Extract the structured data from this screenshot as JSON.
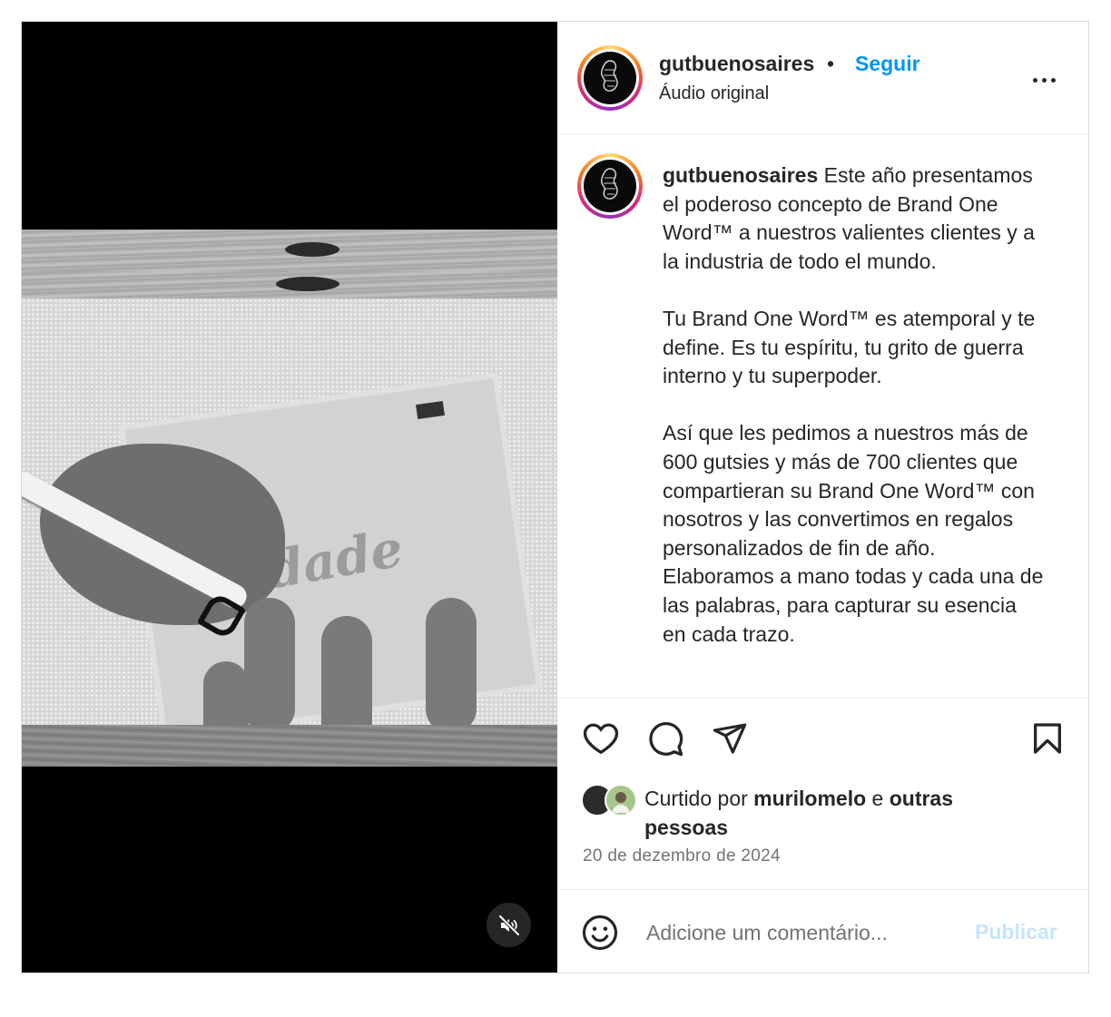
{
  "header": {
    "username": "gutbuenosaires",
    "separator": "•",
    "follow_label": "Seguir",
    "audio_label": "Áudio original"
  },
  "caption": {
    "username": "gutbuenosaires",
    "paragraph_1": "Este año presentamos el poderoso concepto de Brand One Word™ a nuestros valientes clientes y a la industria de todo el mundo.",
    "paragraph_2": "Tu Brand One Word™ es atemporal y te define. Es tu espíritu, tu grito de guerra interno y tu superpoder.",
    "paragraph_3": "Así que les pedimos a nuestros más de 600 gutsies y más de 700 clientes que compartieran su Brand One Word™ con nosotros y las convertimos en regalos personalizados de fin de año. Elaboramos a mano todas y cada una de las palabras, para capturar su esencia en cada trazo."
  },
  "actions": {
    "like_icon": "heart-icon",
    "comment_icon": "comment-icon",
    "share_icon": "share-icon",
    "save_icon": "bookmark-icon"
  },
  "likes": {
    "prefix": "Curtido por",
    "user": "murilomelo",
    "connector": "e",
    "others": "outras pessoas"
  },
  "date": "20 de dezembro de 2024",
  "comment": {
    "placeholder": "Adicione um comentário...",
    "publish_label": "Publicar"
  },
  "media": {
    "mute_icon": "speaker-muted-icon",
    "lettering": "dade"
  },
  "colors": {
    "accent": "#0095f6",
    "publish_disabled": "#c7e3fd",
    "text": "#262626",
    "muted_text": "#737373"
  }
}
